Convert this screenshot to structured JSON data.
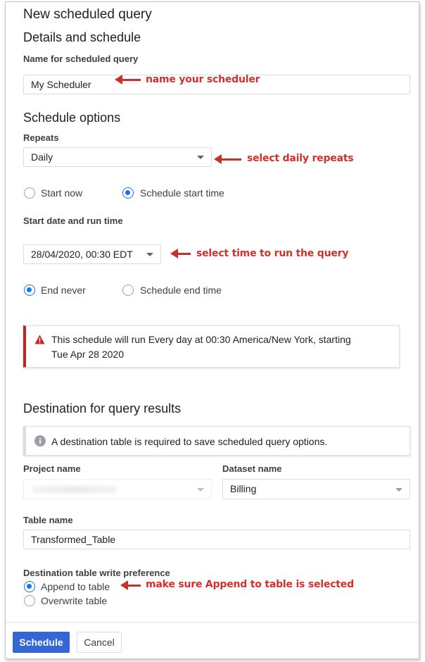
{
  "dialog": {
    "title": "New scheduled query",
    "details_heading": "Details and schedule",
    "name_label": "Name for scheduled query",
    "name_value": "My Scheduler",
    "schedule_options_heading": "Schedule options",
    "repeats_label": "Repeats",
    "repeats_value": "Daily",
    "start_now_label": "Start now",
    "schedule_start_label": "Schedule start time",
    "start_time_label": "Start date and run time",
    "start_time_value": "28/04/2020, 00:30 EDT",
    "end_never_label": "End never",
    "schedule_end_label": "Schedule end time",
    "warning_text_line1": "This schedule will run Every day at 00:30 America/New York, starting",
    "warning_text_line2": "Tue Apr 28 2020",
    "destination_heading": "Destination for query results",
    "info_text": "A destination table is required to save scheduled query options.",
    "project_label": "Project name",
    "project_value": "",
    "dataset_label": "Dataset name",
    "dataset_value": "Billing",
    "table_label": "Table name",
    "table_value": "Transformed_Table",
    "write_pref_label": "Destination table write preference",
    "append_label": "Append to table",
    "overwrite_label": "Overwrite table",
    "schedule_button": "Schedule",
    "cancel_button": "Cancel"
  },
  "radio_state": {
    "start_now": false,
    "schedule_start": true,
    "end_never": true,
    "schedule_end": false,
    "append": true,
    "overwrite": false
  },
  "annotations": {
    "name": "name your scheduler",
    "repeats": "select daily repeats",
    "time": "select time to run the query",
    "append": "make sure Append to table is selected"
  },
  "colors": {
    "primary": "#1a73e8",
    "warning_bar": "#c5221f",
    "annotation": "#d0312d",
    "button_blue": "#3367d6"
  }
}
